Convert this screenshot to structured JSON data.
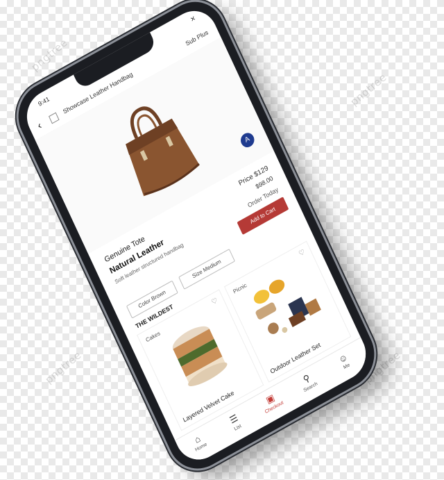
{
  "topbar": {
    "time": "9:41",
    "crumbs": "Showcase Leather Handbag",
    "right": "Sub Plus",
    "close": "×"
  },
  "product": {
    "title": "Genuine Tote",
    "name": "Natural Leather",
    "desc": "Soft leather structured handbag",
    "price_main": "Price $129",
    "price_sub": "$98.00",
    "price_note": "Order Today",
    "buy_label": "Add to Cart",
    "option1": "Color Brown",
    "option2": "Size Medium",
    "badge": "A"
  },
  "grid": {
    "title": "THE WILDEST",
    "cards": [
      {
        "label": "Cakes",
        "caption": "Layered Velvet Cake"
      },
      {
        "label": "Picnic",
        "caption": "Outdoor Leather Set"
      }
    ]
  },
  "nav": [
    {
      "icon": "home-icon",
      "label": "Home"
    },
    {
      "icon": "list-icon",
      "label": "List"
    },
    {
      "icon": "cart-icon",
      "label": "Checkout"
    },
    {
      "icon": "search-icon",
      "label": "Search"
    },
    {
      "icon": "profile-icon",
      "label": "Me"
    }
  ],
  "watermark": "pngtree",
  "colors": {
    "accent": "#b53a36",
    "fab": "#1f3b8f",
    "leather": "#8a5530"
  }
}
